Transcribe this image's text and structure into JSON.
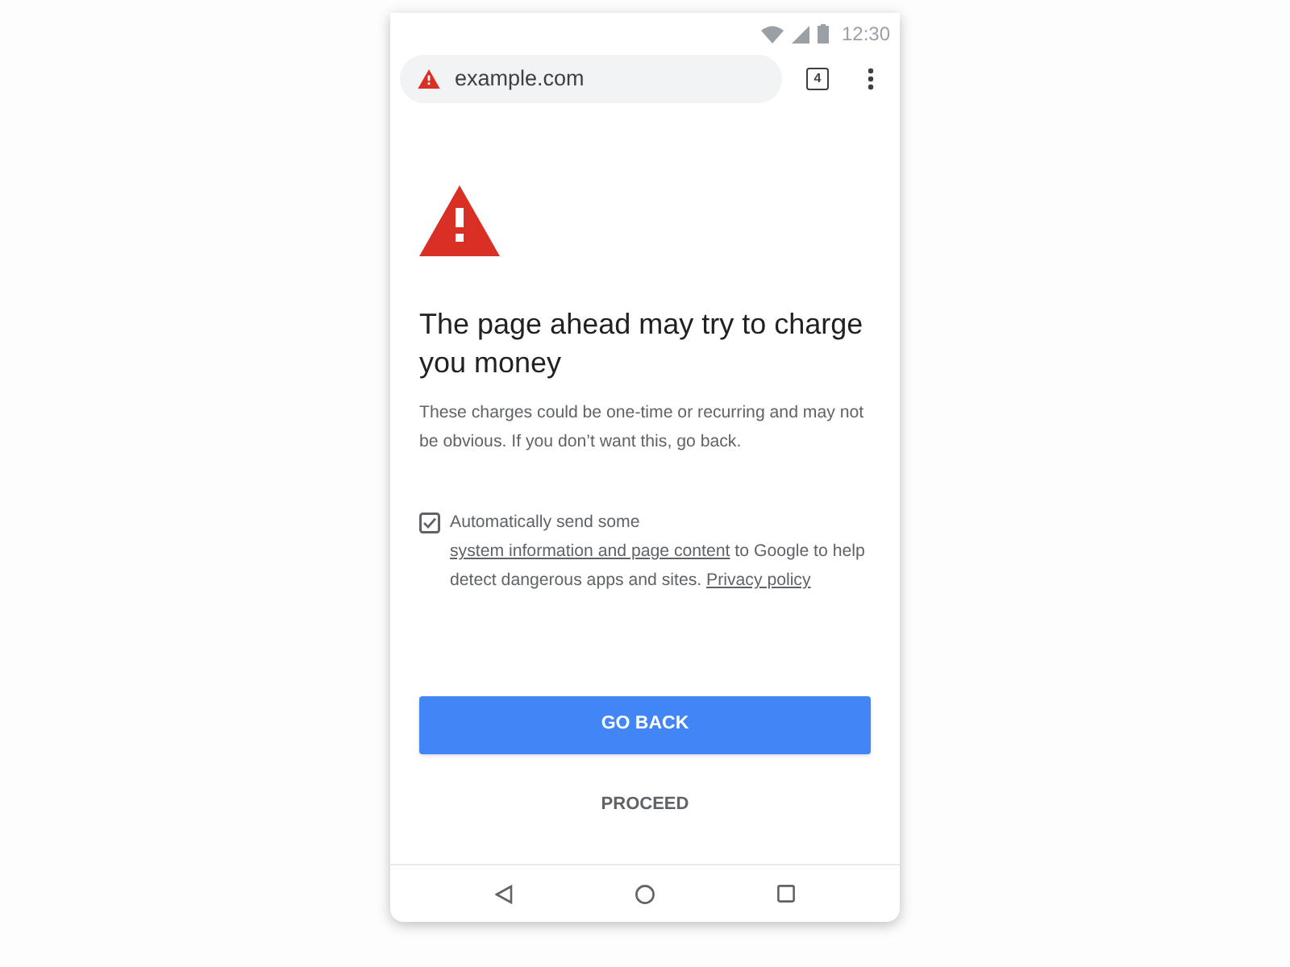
{
  "status_bar": {
    "time": "12:30"
  },
  "toolbar": {
    "url": "example.com",
    "tab_count": "4"
  },
  "warning": {
    "title": "The page ahead may try to charge you money",
    "description": "These charges could be one-time or recurring and may not be obvious. If you don’t want this, go back."
  },
  "consent": {
    "checked": true,
    "parts": [
      {
        "kind": "text",
        "text": "Automatically send some "
      },
      {
        "kind": "link",
        "text": "system information and page content"
      },
      {
        "kind": "text",
        "text": " to Google to help detect dangerous apps and sites. "
      },
      {
        "kind": "link",
        "text": "Privacy policy"
      }
    ]
  },
  "buttons": [
    {
      "kind": "primary",
      "label": "GO BACK"
    },
    {
      "kind": "text",
      "label": "PROCEED"
    }
  ]
}
